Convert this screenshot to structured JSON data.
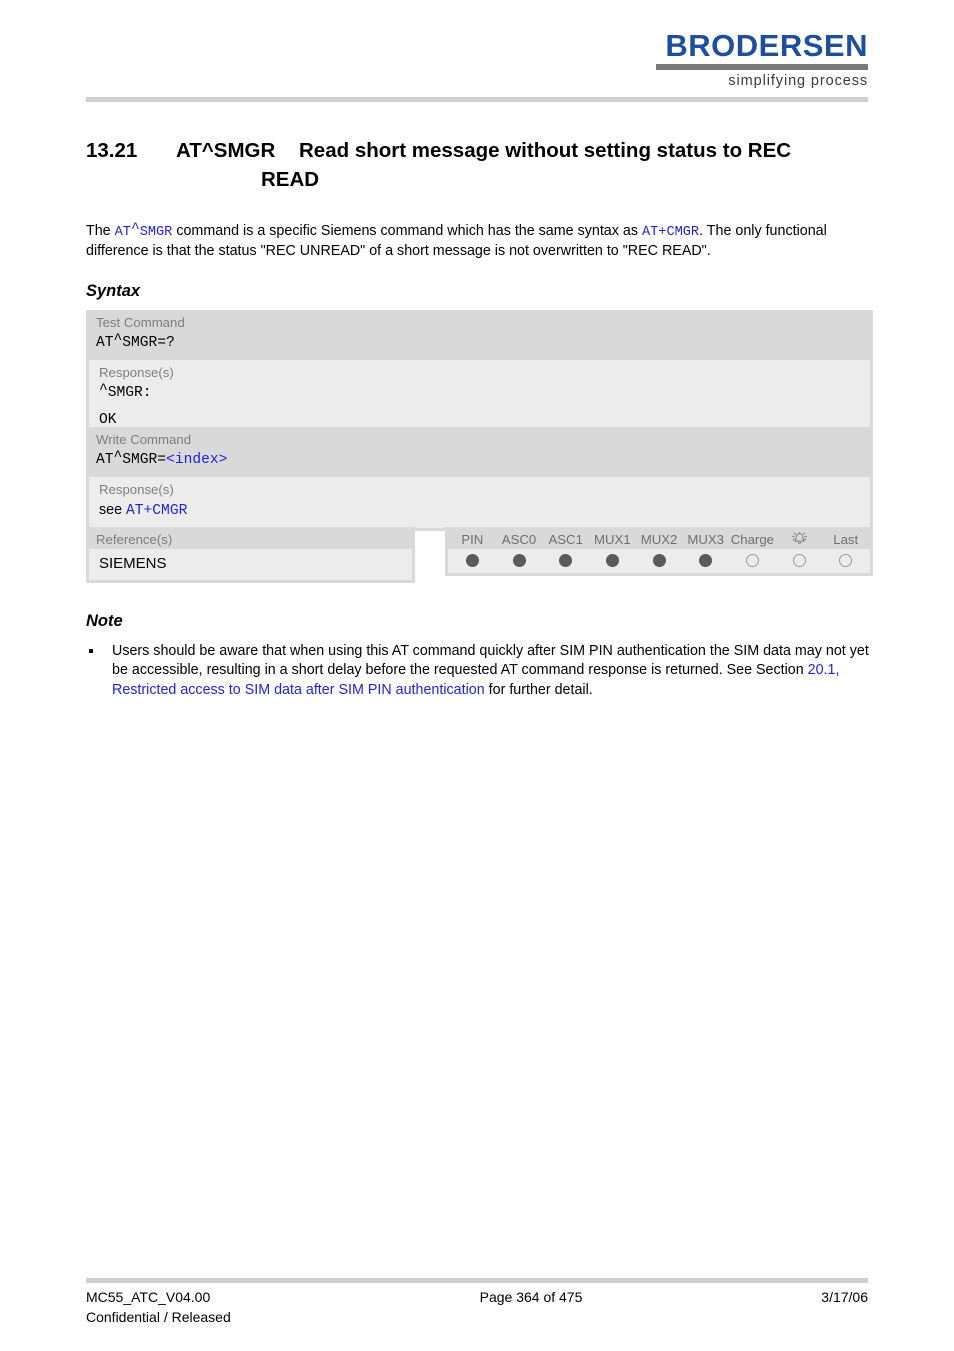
{
  "header": {
    "logo_word": "BRODERSEN",
    "logo_tagline": "simplifying process"
  },
  "heading": {
    "number": "13.21",
    "command": "AT^SMGR",
    "title_line1": "Read short message without setting status to REC",
    "title_line2": "READ"
  },
  "intro": {
    "part1": "The ",
    "link1": "AT^SMGR",
    "part2": " command is a specific Siemens command which has the same syntax as ",
    "link2": "AT+CMGR",
    "part3": ". The only functional difference is that the status \"REC UNREAD\" of a short message is not overwritten to \"REC READ\"."
  },
  "sections": {
    "syntax_label": "Syntax",
    "note_label": "Note"
  },
  "syntax": {
    "test": {
      "command_label": "Test Command",
      "command_text": "AT^SMGR=?",
      "response_label": "Response(s)",
      "response_line1": "^SMGR:",
      "response_line2": "OK"
    },
    "write": {
      "command_label": "Write Command",
      "command_prefix": "AT^SMGR=",
      "command_param": "<index>",
      "response_label": "Response(s)",
      "response_see": "see ",
      "response_link": "AT+CMGR"
    },
    "reference": {
      "label": "Reference(s)",
      "value": "SIEMENS"
    }
  },
  "capability_table": {
    "columns": [
      {
        "label": "PIN",
        "state": "filled",
        "icon": null
      },
      {
        "label": "ASC0",
        "state": "filled",
        "icon": null
      },
      {
        "label": "ASC1",
        "state": "filled",
        "icon": null
      },
      {
        "label": "MUX1",
        "state": "filled",
        "icon": null
      },
      {
        "label": "MUX2",
        "state": "filled",
        "icon": null
      },
      {
        "label": "MUX3",
        "state": "filled",
        "icon": null
      },
      {
        "label": "Charge",
        "state": "empty",
        "icon": null
      },
      {
        "label": "",
        "state": "empty",
        "icon": "alarm-bell-icon"
      },
      {
        "label": "Last",
        "state": "empty",
        "icon": null
      }
    ]
  },
  "note": {
    "items": [
      {
        "part1": "Users should be aware that when using this AT command quickly after SIM PIN authentication the SIM data may not yet be accessible, resulting in a short delay before the requested AT command response is returned. See Section ",
        "link": "20.1, Restricted access to SIM data after SIM PIN authentication",
        "part2": " for further detail."
      }
    ]
  },
  "footer": {
    "doc_id": "MC55_ATC_V04.00",
    "classification": "Confidential / Released",
    "page": "Page 364 of 475",
    "date": "3/17/06"
  },
  "colors": {
    "brand_blue": "#1f4e9c",
    "link_blue": "#2323d7",
    "block_gray": "#d9d9d9",
    "panel_gray": "#ececec",
    "rule_gray": "#cfcfcf",
    "dot_gray": "#5a5a5a"
  }
}
